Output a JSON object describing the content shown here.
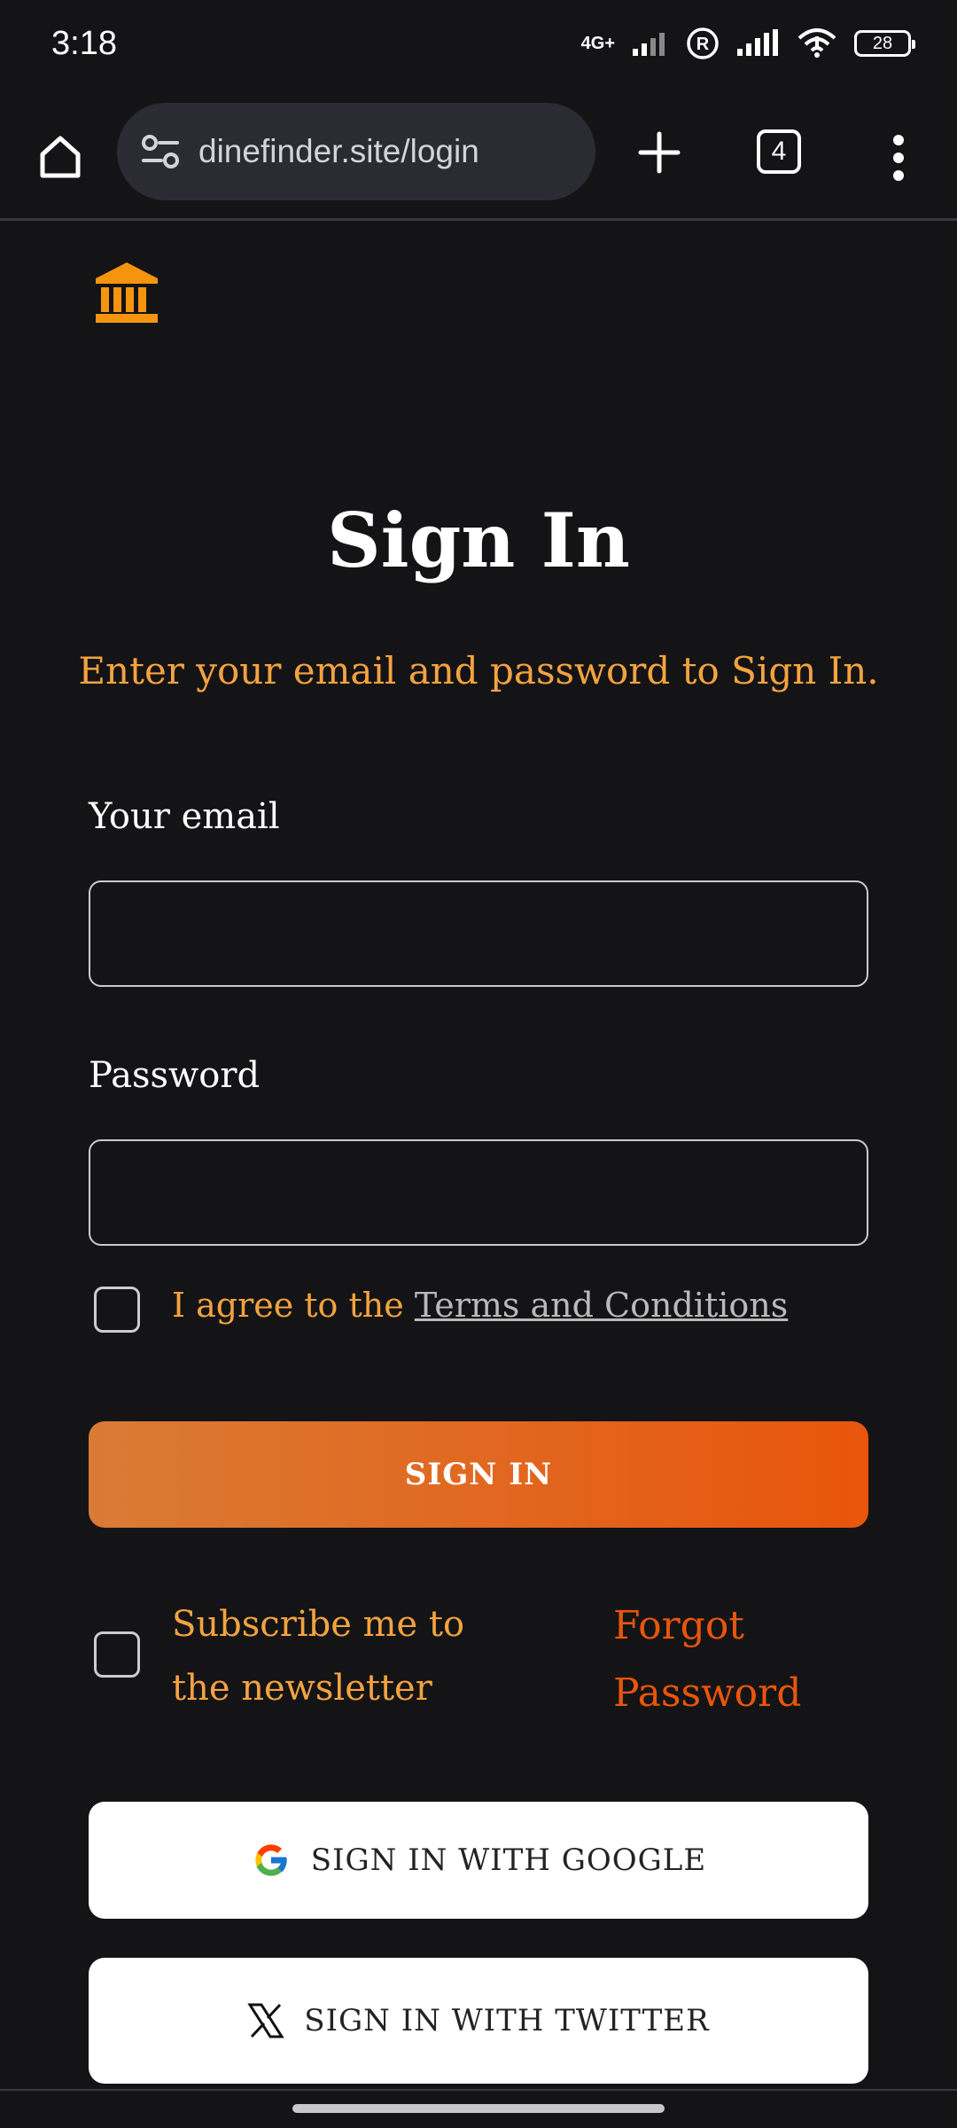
{
  "status_bar": {
    "time": "3:18",
    "network": "4G+",
    "battery": "28"
  },
  "browser": {
    "url": "dinefinder.site/login",
    "tab_count": "4"
  },
  "page": {
    "title": "Sign In",
    "subtitle": "Enter your email and password to Sign In.",
    "email_label": "Your email",
    "email_value": "",
    "password_label": "Password",
    "password_value": "",
    "terms_prefix": "I agree to the ",
    "terms_link": "Terms and Conditions",
    "sign_in_button": "SIGN IN",
    "newsletter_label": "Subscribe me to the newsletter",
    "forgot_password": "Forgot Password",
    "google_button": "SIGN IN WITH GOOGLE",
    "twitter_button": "SIGN IN WITH TWITTER"
  },
  "icons": {
    "logo": "bank-icon",
    "home": "home-icon",
    "site_settings": "tune-icon",
    "new_tab": "plus-icon",
    "menu": "more-vert-icon",
    "google": "google-icon",
    "twitter": "x-icon"
  },
  "colors": {
    "background": "#141416",
    "accent": "#f5a340",
    "button_start": "#d97b35",
    "button_end": "#e9550c",
    "link": "#e9550c"
  }
}
